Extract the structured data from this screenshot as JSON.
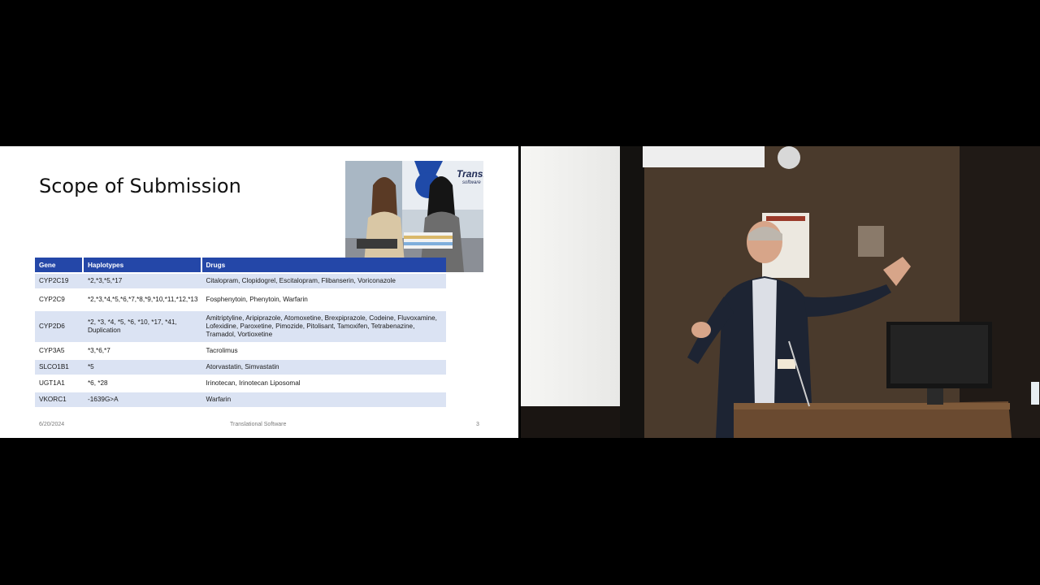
{
  "slide": {
    "title": "Scope of Submission",
    "photo_sign": "Transla",
    "photo_sign_sub": "software",
    "table": {
      "headers": [
        "Gene",
        "Haplotypes",
        "Drugs"
      ],
      "rows": [
        {
          "gene": "CYP2C19",
          "haplotypes": "*2,*3,*5,*17",
          "drugs": "Citalopram, Clopidogrel, Escitalopram, Flibanserin, Voriconazole"
        },
        {
          "gene": "CYP2C9",
          "haplotypes": "*2,*3,*4,*5,*6,*7,*8,*9,*10,*11,*12,*13",
          "drugs": "Fosphenytoin, Phenytoin, Warfarin"
        },
        {
          "gene": "CYP2D6",
          "haplotypes": "*2, *3, *4, *5, *6, *10, *17, *41, Duplication",
          "drugs": "Amitriptyline, Aripiprazole, Atomoxetine, Brexpiprazole, Codeine, Fluvoxamine, Lofexidine, Paroxetine, Pimozide, Pitolisant, Tamoxifen, Tetrabenazine, Tramadol, Vortioxetine"
        },
        {
          "gene": "CYP3A5",
          "haplotypes": "*3,*6,*7",
          "drugs": "Tacrolimus"
        },
        {
          "gene": "SLCO1B1",
          "haplotypes": "*5",
          "drugs": "Atorvastatin, Simvastatin"
        },
        {
          "gene": "UGT1A1",
          "haplotypes": "*6, *28",
          "drugs": "Irinotecan, Irinotecan Liposomal"
        },
        {
          "gene": "VKORC1",
          "haplotypes": "-1639G>A",
          "drugs": "Warfarin"
        }
      ]
    },
    "footer": {
      "date": "6/20/2024",
      "center": "Translational Software",
      "page": "3"
    }
  },
  "colors": {
    "header_blue": "#2447a8",
    "row_alt": "#dbe3f3",
    "background": "#000000"
  }
}
